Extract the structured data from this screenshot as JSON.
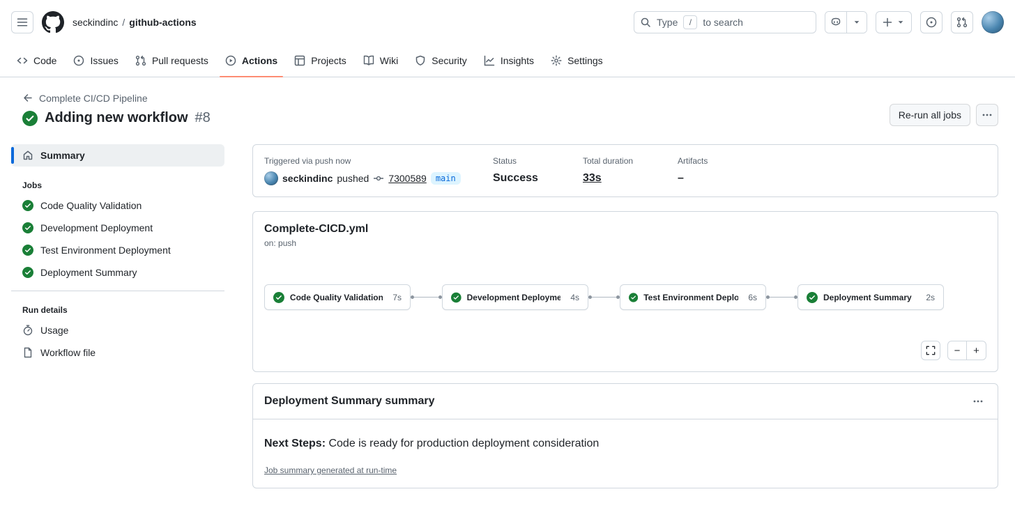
{
  "header": {
    "owner": "seckindinc",
    "separator": "/",
    "repo": "github-actions",
    "search": {
      "text_before": "Type",
      "slash_key": "/",
      "text_after": "to search"
    }
  },
  "repo_nav": {
    "tabs": [
      {
        "label": "Code"
      },
      {
        "label": "Issues"
      },
      {
        "label": "Pull requests"
      },
      {
        "label": "Actions"
      },
      {
        "label": "Projects"
      },
      {
        "label": "Wiki"
      },
      {
        "label": "Security"
      },
      {
        "label": "Insights"
      },
      {
        "label": "Settings"
      }
    ]
  },
  "run_header": {
    "back_link": "Complete CI/CD Pipeline",
    "title": "Adding new workflow",
    "run_number": "#8",
    "rerun_all_jobs": "Re-run all jobs"
  },
  "sidebar": {
    "summary": "Summary",
    "jobs_header": "Jobs",
    "jobs": [
      {
        "name": "Code Quality Validation"
      },
      {
        "name": "Development Deployment"
      },
      {
        "name": "Test Environment Deployment"
      },
      {
        "name": "Deployment Summary"
      }
    ],
    "run_details_header": "Run details",
    "usage": "Usage",
    "workflow_file": "Workflow file"
  },
  "trigger_card": {
    "triggered_label": "Triggered via push now",
    "actor": "seckindinc",
    "action": "pushed",
    "commit_sha": "7300589",
    "branch": "main",
    "status_label": "Status",
    "status_value": "Success",
    "duration_label": "Total duration",
    "duration_value": "33s",
    "artifacts_label": "Artifacts",
    "artifacts_value": "–"
  },
  "workflow_card": {
    "file_name": "Complete-CICD.yml",
    "trigger": "on: push",
    "nodes": [
      {
        "name": "Code Quality Validation",
        "duration": "7s"
      },
      {
        "name": "Development Deployment",
        "duration": "4s"
      },
      {
        "name": "Test Environment Deploym...",
        "duration": "6s"
      },
      {
        "name": "Deployment Summary",
        "duration": "2s"
      }
    ]
  },
  "summary_card": {
    "title": "Deployment Summary summary",
    "next_steps_label": "Next Steps:",
    "next_steps_text": " Code is ready for production deployment consideration",
    "footer_link": "Job summary generated at run-time"
  },
  "icons": {
    "zoom_out": "−",
    "zoom_in": "+"
  },
  "colors": {
    "accent_blue": "#0969da",
    "success_green": "#1a7f37",
    "tab_active_underline": "#fd8c73",
    "border": "#d0d7de",
    "muted_text": "#59636e",
    "branch_badge_bg": "#ddf4ff"
  }
}
